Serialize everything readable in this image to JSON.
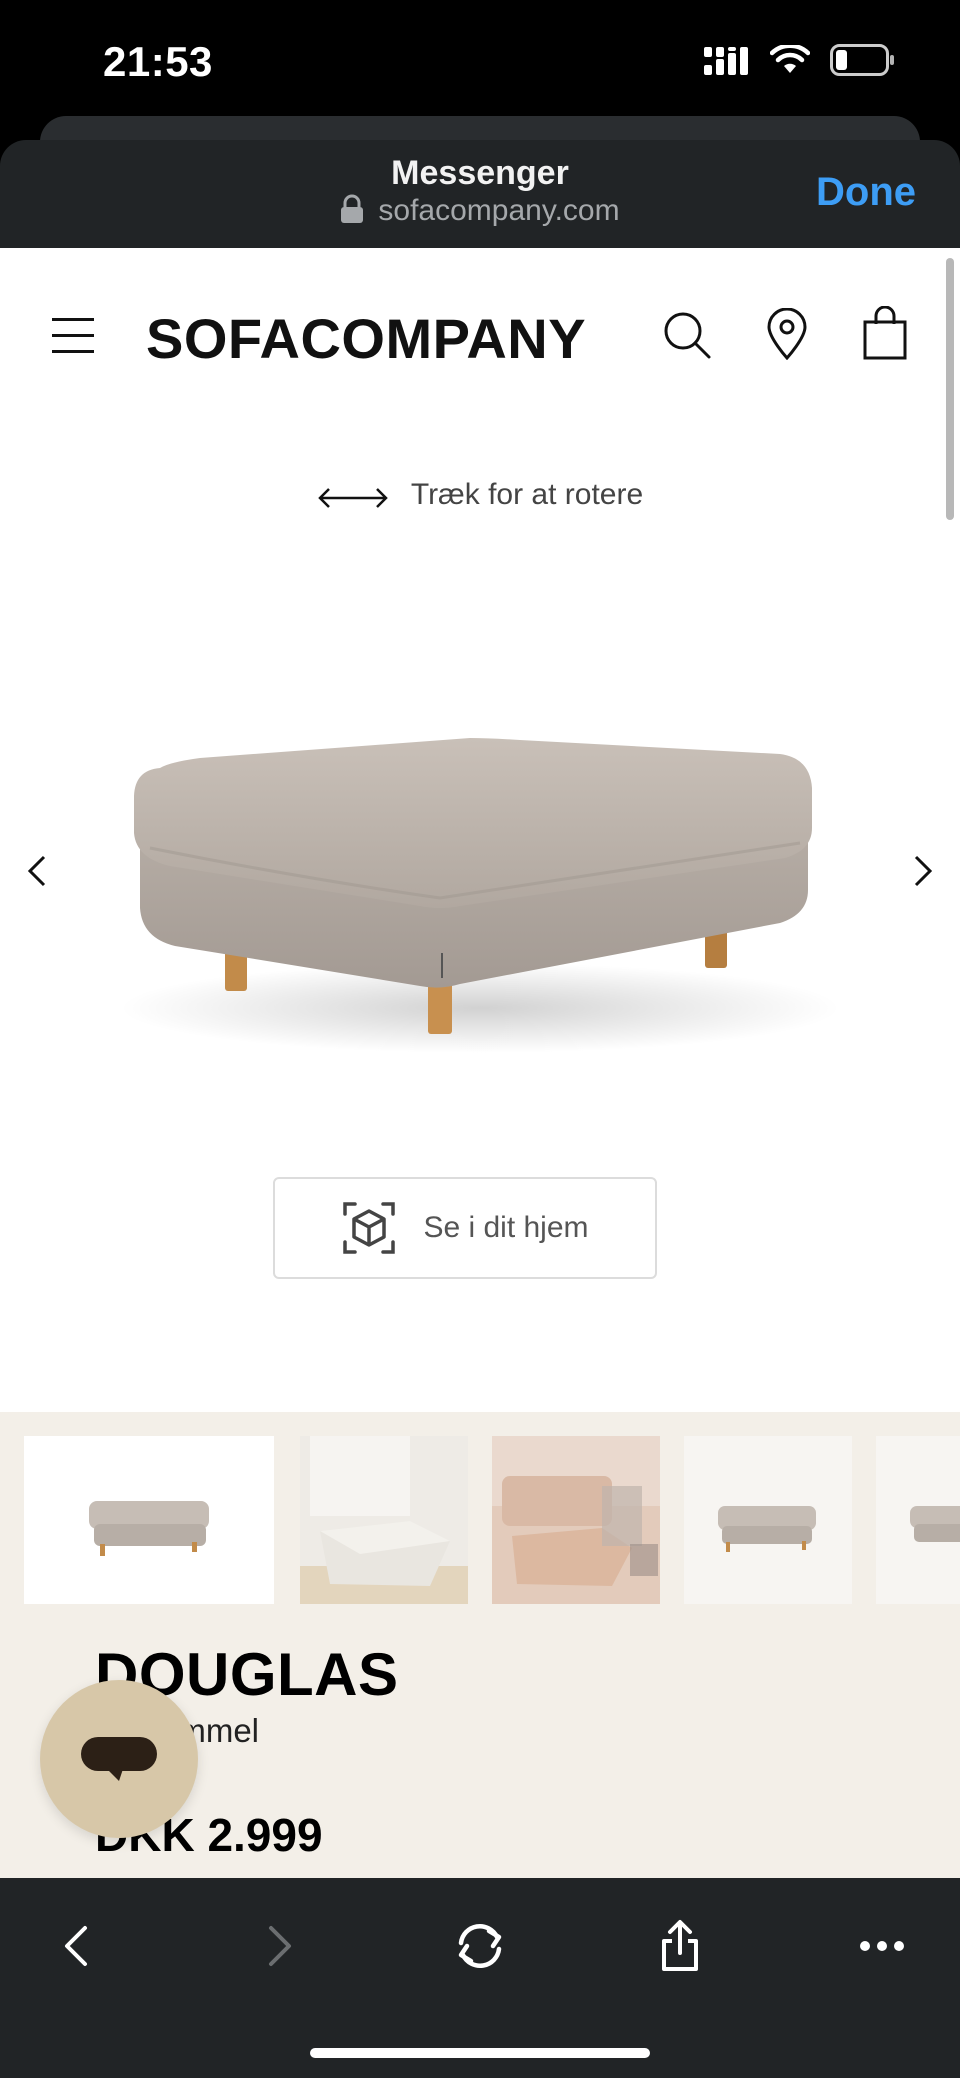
{
  "status_bar": {
    "time": "21:53"
  },
  "browser": {
    "title": "Messenger",
    "url": "sofacompany.com",
    "done_label": "Done"
  },
  "site": {
    "logo": "SOFACOMPANY",
    "rotate_hint": "Træk for at rotere",
    "ar_button_label": "Se i dit hjem"
  },
  "product": {
    "name": "DOUGLAS",
    "subtitle_visible": "ammel",
    "price": "DKK 2.999"
  },
  "icons": {
    "menu": "hamburger-menu-icon",
    "search": "search-icon",
    "location": "location-pin-icon",
    "cart": "shopping-bag-icon",
    "chat": "chat-bubble-icon"
  },
  "colors": {
    "accent": "#3d9df5",
    "chrome": "#212426",
    "beige": "#f3efe8",
    "chat_fab": "#d7c7a8"
  }
}
